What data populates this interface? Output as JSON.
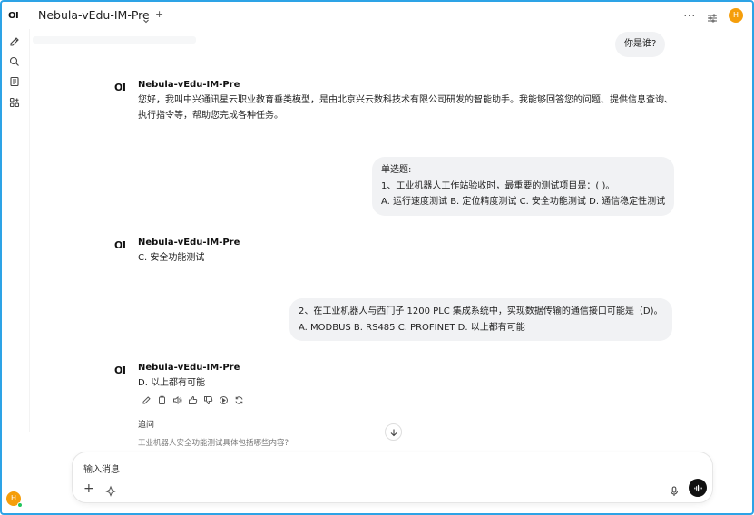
{
  "rail": {
    "logo": "OI",
    "icons": [
      "new-chat-icon",
      "search-icon",
      "notes-icon",
      "workspace-icon"
    ],
    "avatar_initial": "H"
  },
  "header": {
    "model_name": "Nebula-vEdu-IM-Pre",
    "add_model_label": "+",
    "more_label": "···",
    "user_initial": "H"
  },
  "messages": {
    "user_1": "你是谁?",
    "ai_1": {
      "avatar": "OI",
      "name": "Nebula-vEdu-IM-Pre",
      "text": "您好，我叫中兴通讯星云职业教育垂类模型，是由北京兴云数科技术有限公司研发的智能助手。我能够回答您的问题、提供信息查询、执行指令等，帮助您完成各种任务。"
    },
    "user_2": {
      "line1": "单选题:",
      "line2": "1、工业机器人工作站验收时，最重要的测试项目是：( )。",
      "line3": "A. 运行速度测试 B. 定位精度测试 C. 安全功能测试 D. 通信稳定性测试"
    },
    "ai_2": {
      "avatar": "OI",
      "name": "Nebula-vEdu-IM-Pre",
      "text": "C. 安全功能测试"
    },
    "user_3": {
      "line1": "2、在工业机器人与西门子 1200 PLC 集成系统中，实现数据传输的通信接口可能是（D)。",
      "line2": "A. MODBUS B. RS485 C. PROFINET D. 以上都有可能"
    },
    "ai_3": {
      "avatar": "OI",
      "name": "Nebula-vEdu-IM-Pre",
      "text": "D. 以上都有可能"
    }
  },
  "actions": [
    "edit-icon",
    "copy-icon",
    "read-aloud-icon",
    "thumbs-up-icon",
    "thumbs-down-icon",
    "continue-icon",
    "regenerate-icon"
  ],
  "followup": {
    "title": "追问",
    "items": [
      "工业机器人安全功能测试具体包括哪些内容?"
    ]
  },
  "composer": {
    "placeholder": "输入消息",
    "add_label": "+"
  }
}
